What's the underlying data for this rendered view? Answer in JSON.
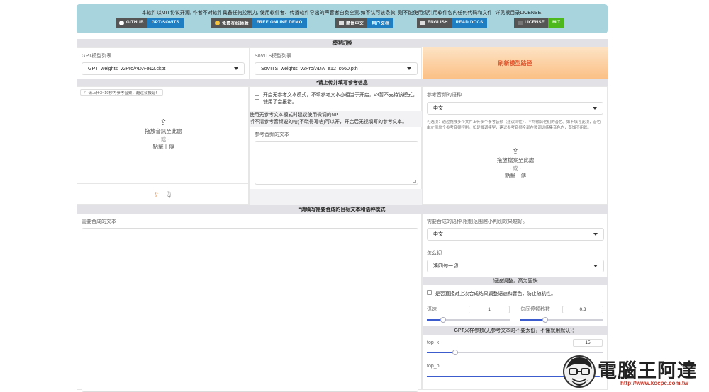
{
  "notice": {
    "text": "本软件以MIT协议开源, 作者不对软件具备任何控制力, 使用软件者、传播软件导出的声音者自负全责.如不认可该条款, 则不能使用或引用软件包内任何代码和文件. 详见根目录LICENSE.",
    "badges": [
      {
        "left": "GITHUB",
        "right": "GPT-SOVITS",
        "icon": "github-icon"
      },
      {
        "left": "免费在线体验",
        "right": "FREE ONLINE DEMO",
        "icon": "emoji-icon"
      },
      {
        "left": "简体中文",
        "right": "用户文档",
        "icon": "doc-icon"
      },
      {
        "left": "ENGLISH",
        "right": "READ DOCS",
        "icon": "doc-icon"
      },
      {
        "left": "LICENSE",
        "right": "MIT",
        "icon": "license-icon"
      }
    ]
  },
  "model_switch": {
    "title": "模型切换",
    "gpt_label": "GPT模型列表",
    "gpt_value": "GPT_weights_v2Pro/ADA-e12.ckpt",
    "sovits_label": "SoVITS模型列表",
    "sovits_value": "SoVITS_weights_v2Pro/ADA_e12_s660.pth",
    "refresh_label": "刷新模型路径"
  },
  "reference": {
    "title": "*请上传并填写参考信息",
    "upload_hint": "请上传3~10秒内参考音频，超过会报错！",
    "drop_text": "拖放音訊至此處",
    "or_text": "- 或 -",
    "click_text": "點擊上傳",
    "free_mode_label": "开启无参考文本模式，不填参考文本亦相当于开启，v3暂不支持该模式，使用了会报错。",
    "free_mode_note_1": "使用无参考文本模式时建议使用微调的GPT",
    "free_mode_note_2": "听不清参考音频说的啥(不晓得写啥)可以开，开启后无视填写的参考文本。",
    "ref_text_label": "参考音频的文本",
    "lang_label": "参考音频的语种",
    "lang_value": "中文",
    "aux_note": "可选项：通过拖拽多个文件上传多个参考音频（建议同性），平均融合他们的音色。如不填写此项，音色由左侧单个参考音频控制。如是微调模型，建议参考音频全部在微调训练集音色内，蒸馏不用管。",
    "aux_drop_text": "拖放檔案至此處",
    "aux_or_text": "- 或 -",
    "aux_click_text": "點擊上傳"
  },
  "synthesis": {
    "title": "*请填写需要合成的目标文本和语种模式",
    "target_label": "需要合成的文本",
    "target_lang_label": "需要合成的语种.限制范围越小判别效果越好。",
    "target_lang_value": "中文",
    "cut_label": "怎么切",
    "cut_value": "凑四句一切",
    "speed_section": "语速调整，高为更快",
    "keep_random_label": "是否直接对上次合成结果调整语速和音色，防止随机性。",
    "speed_label": "语速",
    "speed_value": "1",
    "speed_fraction": 0.2,
    "pause_label": "句间停顿秒数",
    "pause_value": "0.3",
    "pause_fraction": 0.3,
    "gpt_params_section": "GPT采样参数(无参考文本时不要太低，不懂就用默认)：",
    "topk_label": "top_k",
    "topk_value": "15",
    "topk_fraction": 0.16,
    "topp_label": "top_p"
  },
  "watermark": {
    "brand": "電腦王阿達",
    "url": "http://www.kocpc.com.tw"
  },
  "colors": {
    "notice_bg": "#a8d4de",
    "refresh_gradient_top": "#fde3c4",
    "refresh_gradient_bottom": "#fbbf84",
    "refresh_text": "#e2512a",
    "slider_blue": "#3c5bcc",
    "upload_orange": "#f08a24"
  }
}
